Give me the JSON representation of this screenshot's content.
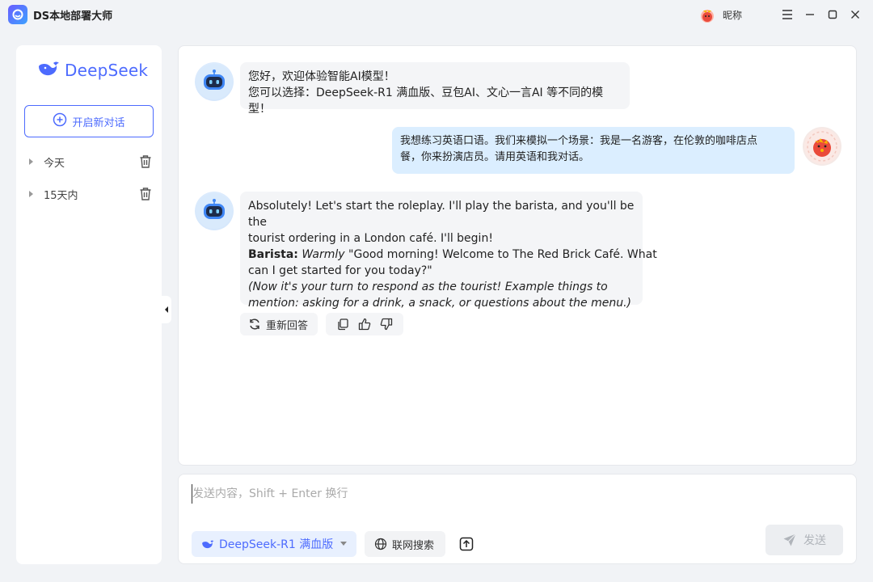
{
  "window": {
    "title": "DS本地部署大师",
    "nickname": "昵称"
  },
  "sidebar": {
    "brand": "DeepSeek",
    "new_chat_label": "开启新对话",
    "groups": [
      {
        "label": "今天"
      },
      {
        "label": "15天内"
      }
    ]
  },
  "chat": {
    "messages": [
      {
        "role": "assistant",
        "lines": [
          "您好，欢迎体验智能AI模型！",
          "您可以选择：DeepSeek-R1 满血版、豆包AI、文心一言AI 等不同的模型！"
        ]
      },
      {
        "role": "user",
        "lines": [
          "我想练习英语口语。我们来模拟一个场景：我是一名游客，在伦敦的咖啡店点",
          "餐，你来扮演店员。请用英语和我对话。"
        ]
      },
      {
        "role": "assistant",
        "intro": [
          "Absolutely! Let's start the roleplay. I'll play the barista, and you'll be the",
          "tourist ordering in a London café. I'll begin!"
        ],
        "speaker": "Barista:",
        "manner": "Warmly",
        "quote": [
          " \"Good morning! Welcome to The Red Brick Café. What",
          "can I get started for you today?\""
        ],
        "note": [
          "(Now it's your turn to respond as the tourist! Example things to",
          "mention: asking for a drink, a snack, or questions about the menu.)"
        ]
      }
    ],
    "actions": {
      "regenerate_label": "重新回答"
    }
  },
  "composer": {
    "placeholder": "发送内容，Shift + Enter 换行",
    "model_label": "DeepSeek-R1 满血版",
    "web_search_label": "联网搜索",
    "send_label": "发送"
  },
  "colors": {
    "accent": "#4d6bfe",
    "user_bubble": "#dbeeff",
    "bot_bubble": "#f4f5f7",
    "background": "#f1f3f6"
  }
}
